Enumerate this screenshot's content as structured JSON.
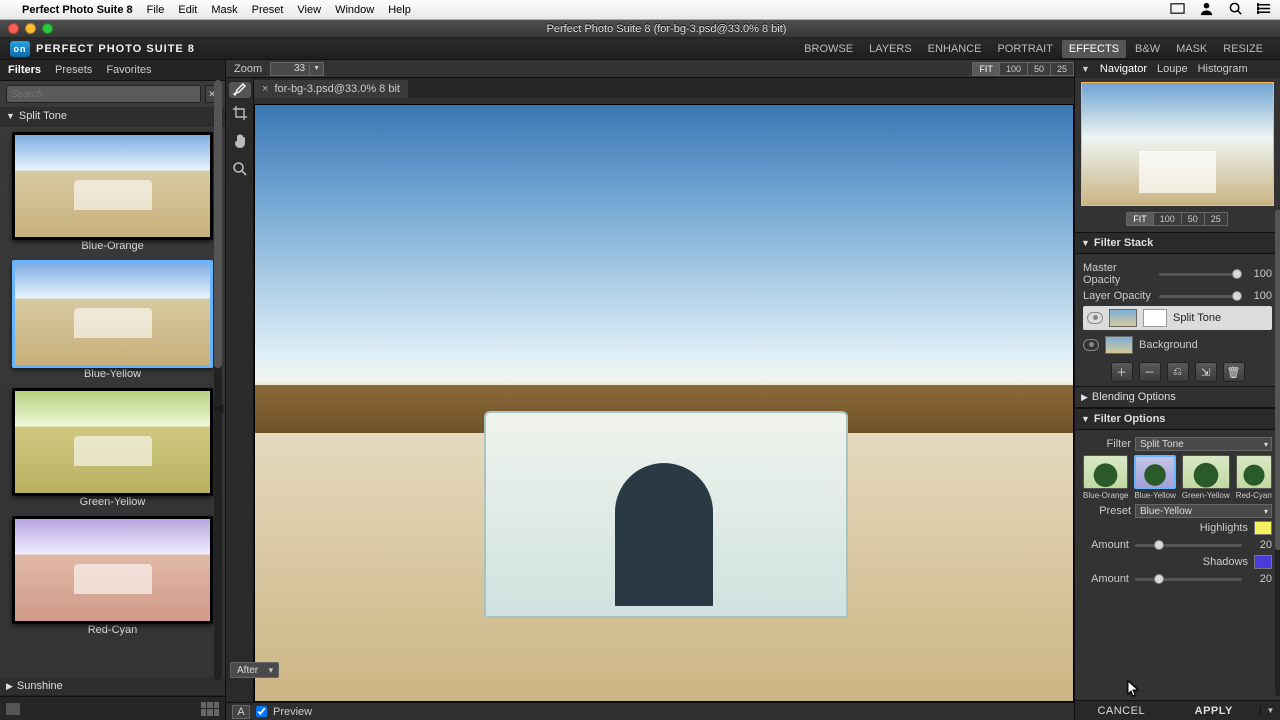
{
  "mac_menu": {
    "apple": "",
    "app": "Perfect Photo Suite 8",
    "items": [
      "File",
      "Edit",
      "Mask",
      "Preset",
      "View",
      "Window",
      "Help"
    ]
  },
  "titlebar": "Perfect Photo Suite 8 (for-bg-3.psd@33.0% 8 bit)",
  "logo": "PERFECT PHOTO SUITE 8",
  "modes": [
    "BROWSE",
    "LAYERS",
    "ENHANCE",
    "PORTRAIT",
    "EFFECTS",
    "B&W",
    "MASK",
    "RESIZE"
  ],
  "mode_active": "EFFECTS",
  "left_tabs": [
    "Filters",
    "Presets",
    "Favorites"
  ],
  "left_tab_active": "Filters",
  "search_placeholder": "Search",
  "left_sections": [
    {
      "title": "Split Tone",
      "open": true,
      "presets": [
        {
          "label": "Blue-Orange",
          "cls": ""
        },
        {
          "label": "Blue-Yellow",
          "cls": "sel"
        },
        {
          "label": "Green-Yellow",
          "cls": "gy"
        },
        {
          "label": "Red-Cyan",
          "cls": "rc"
        }
      ]
    },
    {
      "title": "Sunshine",
      "open": false
    }
  ],
  "zoom": {
    "label": "Zoom",
    "value": "33",
    "pills": [
      "FIT",
      "100",
      "50",
      "25"
    ],
    "active": "FIT"
  },
  "doc_tab": "for-bg-3.psd@33.0% 8 bit",
  "view_mode": "After",
  "preview_label": "Preview",
  "nav_tabs": [
    "Navigator",
    "Loupe",
    "Histogram"
  ],
  "nav_active": "Navigator",
  "nav_zoom": {
    "pills": [
      "FIT",
      "100",
      "50",
      "25"
    ],
    "active": "FIT"
  },
  "filter_stack": {
    "title": "Filter Stack",
    "master": {
      "label": "Master Opacity",
      "value": "100",
      "pos": 100
    },
    "layer": {
      "label": "Layer Opacity",
      "value": "100",
      "pos": 100
    },
    "layers": [
      {
        "name": "Split Tone",
        "sel": true,
        "mask": true
      },
      {
        "name": "Background",
        "sel": false,
        "mask": false
      }
    ],
    "blending": "Blending Options"
  },
  "filter_options": {
    "title": "Filter Options",
    "filter": {
      "label": "Filter",
      "value": "Split Tone"
    },
    "swatches": [
      "Blue-Orange",
      "Blue-Yellow",
      "Green-Yellow",
      "Red-Cyan"
    ],
    "swatch_active": 1,
    "preset": {
      "label": "Preset",
      "value": "Blue-Yellow"
    },
    "highlights": {
      "label": "Highlights",
      "color": "#f4f060",
      "amount_label": "Amount",
      "amount": "20",
      "pos": 20
    },
    "shadows": {
      "label": "Shadows",
      "color": "#4a3cd8",
      "amount_label": "Amount",
      "amount": "20",
      "pos": 20
    }
  },
  "footer": {
    "cancel": "CANCEL",
    "apply": "APPLY"
  }
}
